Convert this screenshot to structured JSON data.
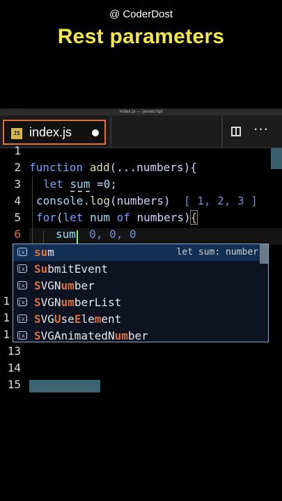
{
  "branding": {
    "handle": "@ CoderDost"
  },
  "headline": "Rest parameters",
  "window": {
    "title": "index.js — javascript"
  },
  "tab": {
    "icon_text": "JS",
    "label": "index.js"
  },
  "editor": {
    "line_numbers": [
      "1",
      "2",
      "3",
      "4",
      "5",
      "6",
      "1",
      "1",
      "1",
      "13",
      "14",
      "15"
    ],
    "lines": {
      "l2": {
        "kw": "function",
        "fn": "add",
        "rest": "(...numbers){"
      },
      "l3": {
        "kw": "let",
        "var": "sum",
        "rest": "=0;"
      },
      "l4": {
        "obj": "console",
        "fn": "log",
        "rest": "(numbers)",
        "hint": "[ 1, 2, 3 ]"
      },
      "l5": {
        "kw": "for",
        "rest1": "(",
        "kw2": "let",
        "var": "num",
        "kw3": "of",
        "rest2": "numbers)",
        "brace": "{"
      },
      "l6": {
        "var": "sum",
        "hint": "0, 0, 0"
      }
    }
  },
  "suggestions": {
    "items": [
      {
        "match": "su",
        "rest": "m",
        "detail": "let sum: number"
      },
      {
        "pre": "",
        "match": "Su",
        "rest": "bmitEvent"
      },
      {
        "pre": "",
        "match": "S",
        "mid": "VGN",
        "match2": "um",
        "rest": "ber"
      },
      {
        "pre": "",
        "match": "S",
        "mid": "VGN",
        "match2": "um",
        "rest": "berList"
      },
      {
        "pre": "",
        "match": "S",
        "mid": "VG",
        "match2": "U",
        "mid2": "se",
        "match3": "E",
        "mid3": "le",
        "match4": "m",
        "rest": "ent"
      },
      {
        "pre": "",
        "match": "S",
        "mid": "VGAnimatedN",
        "match2": "um",
        "rest": "ber"
      }
    ]
  }
}
